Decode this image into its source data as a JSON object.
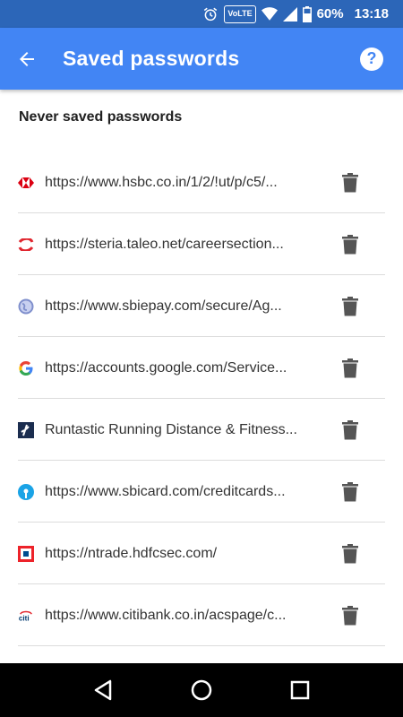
{
  "status_bar": {
    "volte": "VoLTE",
    "battery": "60%",
    "time": "13:18"
  },
  "app_bar": {
    "title": "Saved passwords",
    "help": "?"
  },
  "section": {
    "header": "Never saved passwords"
  },
  "entries": [
    {
      "text": "https://www.hsbc.co.in/1/2/!ut/p/c5/...",
      "icon": "hsbc-icon"
    },
    {
      "text": "https://steria.taleo.net/careersection...",
      "icon": "taleo-icon"
    },
    {
      "text": "https://www.sbiepay.com/secure/Ag...",
      "icon": "globe-icon"
    },
    {
      "text": "https://accounts.google.com/Service...",
      "icon": "google-icon"
    },
    {
      "text": "Runtastic Running Distance & Fitness...",
      "icon": "runtastic-icon"
    },
    {
      "text": "https://www.sbicard.com/creditcards...",
      "icon": "sbi-icon"
    },
    {
      "text": "https://ntrade.hdfcsec.com/",
      "icon": "hdfc-icon"
    },
    {
      "text": "https://www.citibank.co.in/acspage/c...",
      "icon": "citi-icon"
    }
  ],
  "colors": {
    "app_bar": "#4285f4",
    "status_bar": "#2c66b8"
  }
}
